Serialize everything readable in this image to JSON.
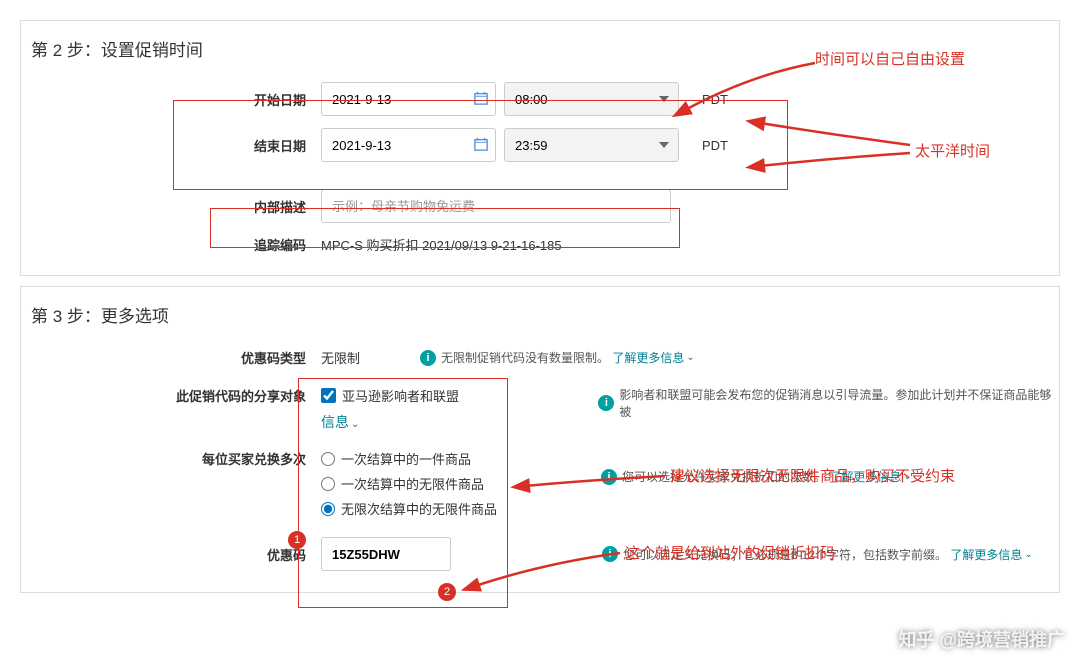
{
  "step2": {
    "title": "第 2 步：设置促销时间",
    "start_label": "开始日期",
    "end_label": "结束日期",
    "start_date": "2021-9-13",
    "start_time": "08:00",
    "end_date": "2021-9-13",
    "end_time": "23:59",
    "tz": "PDT",
    "desc_label": "内部描述",
    "desc_placeholder": "示例：母亲节购物免运费",
    "track_label": "追踪编码",
    "track_value": "MPC-S 购买折扣 2021/09/13 9-21-16-185"
  },
  "step3": {
    "title": "第 3 步：更多选项",
    "type_label": "优惠码类型",
    "type_value": "无限制",
    "type_help": "无限制促销代码没有数量限制。",
    "share_label": "此促销代码的分享对象",
    "share_checkbox": "亚马逊影响者和联盟",
    "share_info_link": "信息",
    "share_help": "影响者和联盟可能会发布您的促销消息以引导流量。参加此计划并不保证商品能够被",
    "redeem_label": "每位买家兑换多次",
    "redeem_opt1": "一次结算中的一件商品",
    "redeem_opt2": "一次结算中的无限件商品",
    "redeem_opt3": "无限次结算中的无限件商品",
    "redeem_help": "您可以选择允许买家兑换折扣的次数。",
    "code_label": "优惠码",
    "code_value": "15Z55DHW",
    "code_help": "您可以自定义兑换码；它必须是8-12个字符，包括数字前缀。",
    "learn_more": "了解更多信息"
  },
  "annotations": {
    "a1": "时间可以自己自由设置",
    "a2": "太平洋时间",
    "a3": "建议选择无限次无限件商品，购买不受约束",
    "a4": "这个就是给到站外的促销折扣码"
  },
  "watermark": "知乎 @跨境营销推广"
}
